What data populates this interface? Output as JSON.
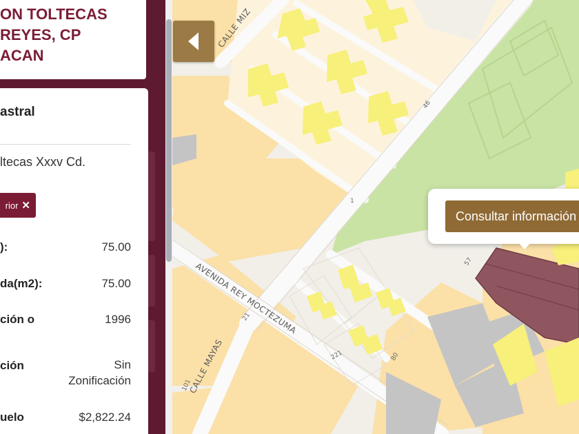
{
  "title": {
    "line1": "ON TOLTECAS",
    "line2": "REYES, CP",
    "line3": "ACAN"
  },
  "card": {
    "heading": "astral",
    "address": "ltecas Xxxv Cd.",
    "filter_chip": "rior"
  },
  "rows": [
    {
      "label": "):",
      "value": "75.00"
    },
    {
      "label": "da(m2):",
      "value": "75.00"
    },
    {
      "label": "ción o",
      "value": "1996"
    },
    {
      "label": "ción",
      "value": "Sin",
      "value2": "Zonificación"
    },
    {
      "label": "uelo",
      "value": "$2,822.24"
    }
  ],
  "map": {
    "streets": {
      "calle_miz": "CALLE MIZ",
      "avenida": "AVENIDA REY MOCTEZUMA",
      "calle_mayas": "CALLE MAYAS"
    },
    "numbers": [
      "46",
      "1",
      "57",
      "21",
      "221",
      "80",
      "101"
    ],
    "colors": {
      "block": "#fbe0a8",
      "road": "#fafafa",
      "park": "#c9e3a4",
      "building": "#f7f07a",
      "selected_lot": "#8f5660",
      "gray_lot": "#c4c4c4"
    }
  },
  "popup": {
    "button_label": "Consultar información"
  },
  "theme": {
    "primary": "#5e1a30",
    "accent": "#9c7a45"
  }
}
